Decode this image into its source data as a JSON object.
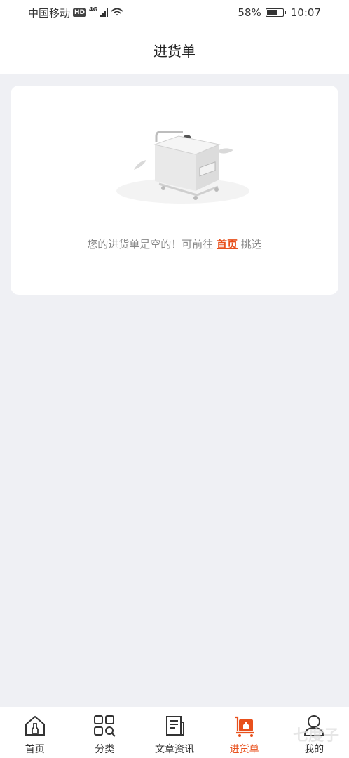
{
  "status_bar": {
    "carrier": "中国移动",
    "hd": "HD",
    "network": "4G",
    "battery": "58%",
    "time": "10:07"
  },
  "header": {
    "title": "进货单"
  },
  "empty": {
    "message_before": "您的进货单是空的！可前往 ",
    "link_label": "首页",
    "message_after": " 挑选"
  },
  "tabbar": {
    "active": "进货单",
    "accent_color": "#e8501c",
    "items": [
      {
        "label": "首页",
        "icon": "home-icon"
      },
      {
        "label": "分类",
        "icon": "category-grid-icon"
      },
      {
        "label": "文章资讯",
        "icon": "news-icon"
      },
      {
        "label": "进货单",
        "icon": "cart-icon"
      },
      {
        "label": "我的",
        "icon": "user-icon"
      }
    ]
  },
  "watermark": "七度子"
}
